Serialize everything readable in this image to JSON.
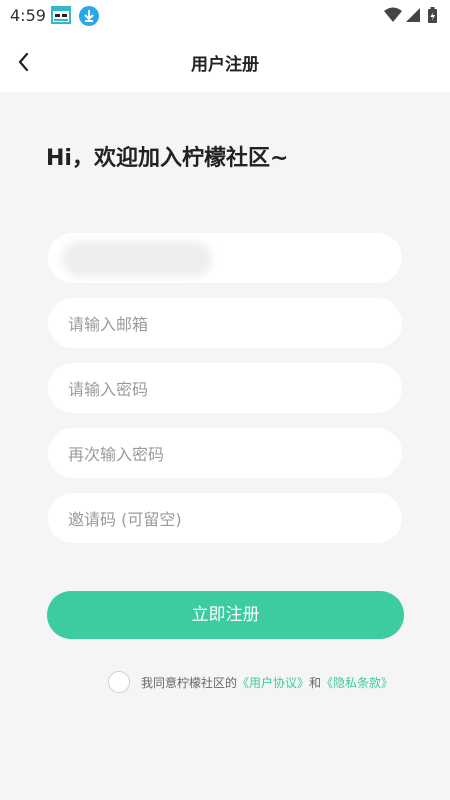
{
  "status_bar": {
    "time": "4:59"
  },
  "header": {
    "title": "用户注册"
  },
  "welcome": "Hi，欢迎加入柠檬社区~",
  "fields": {
    "username_value": "",
    "email_placeholder": "请输入邮箱",
    "password_placeholder": "请输入密码",
    "confirm_placeholder": "再次输入密码",
    "invite_placeholder": "邀请码 (可留空)"
  },
  "submit_label": "立即注册",
  "agreement": {
    "prefix": "我同意柠檬社区的",
    "user_agreement": "《用户协议》",
    "and": "和",
    "privacy_policy": "《隐私条款》"
  },
  "colors": {
    "accent": "#3dcba2",
    "background": "#f5f5f5"
  }
}
